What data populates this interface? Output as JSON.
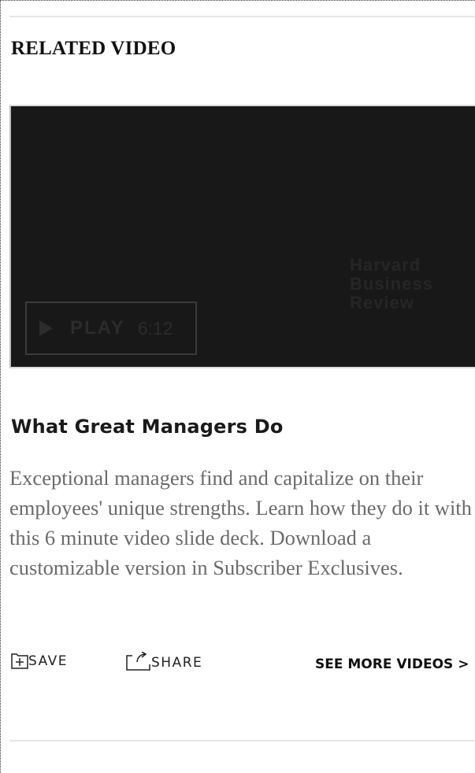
{
  "section": {
    "title": "RELATED VIDEO"
  },
  "video": {
    "watermark_lines": [
      "Harvard",
      "Business",
      "Review"
    ],
    "play_label": "PLAY",
    "duration": "6:12"
  },
  "article": {
    "title": "What Great Managers Do",
    "description": "Exceptional managers find and capitalize on their employees' unique strengths. Learn how they do it with this 6 minute video slide deck. Download a customizable version in Subscriber Exclusives."
  },
  "actions": {
    "save_label": "SAVE",
    "share_label": "SHARE",
    "see_more_label": "SEE MORE VIDEOS >"
  },
  "icons": {
    "save": "folder-plus-icon",
    "share": "share-arrow-icon",
    "play": "play-icon"
  }
}
